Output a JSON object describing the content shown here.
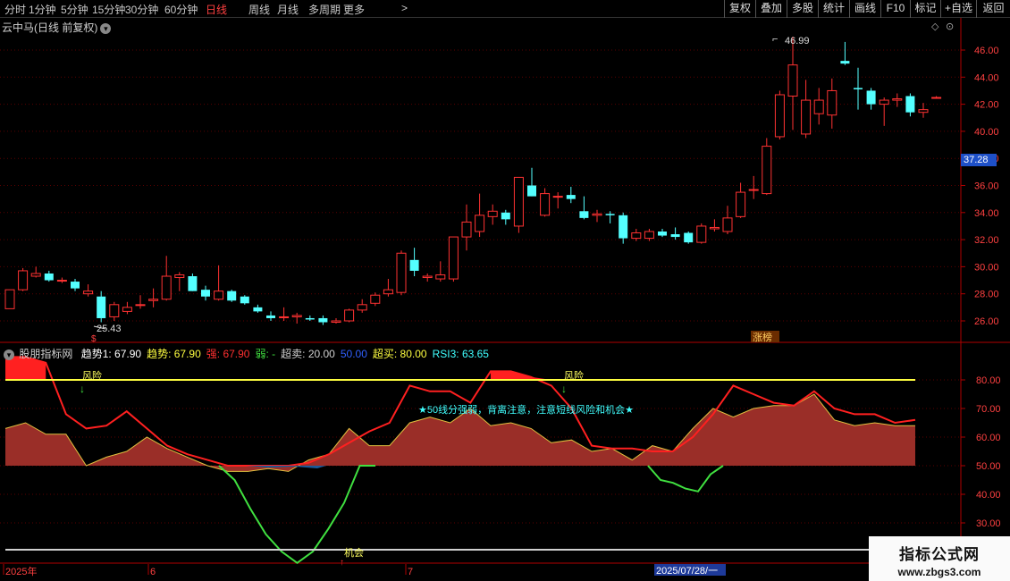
{
  "toolbar": {
    "periods": [
      "分时",
      "1分钟",
      "5分钟",
      "15分钟",
      "30分钟",
      "60分钟",
      "日线",
      "周线",
      "月线",
      "多周期",
      "更多"
    ],
    "active_period": "日线",
    "more_arrow": ">",
    "right_buttons": [
      "复权",
      "叠加",
      "多股",
      "统计",
      "画线",
      "F10",
      "标记",
      "+自选",
      "返回"
    ]
  },
  "stock": {
    "title": "云中马(日线 前复权)",
    "high_label": "46.99",
    "low_label": "25.43",
    "current_price": "37.28",
    "tag_label": "涨榜"
  },
  "price_axis": [
    "46.00",
    "44.00",
    "42.00",
    "40.00",
    "38.00",
    "36.00",
    "34.00",
    "32.00",
    "30.00",
    "28.00",
    "26.00"
  ],
  "indicator": {
    "name": "股朋指标网",
    "items": [
      {
        "label": "趋势1: 67.90",
        "color": "#ffffff"
      },
      {
        "label": "趋势: 67.90",
        "color": "#ffff40"
      },
      {
        "label": "强: 67.90",
        "color": "#ff3030"
      },
      {
        "label": "弱: -",
        "color": "#40e040"
      },
      {
        "label": "超卖: 20.00",
        "color": "#d0d0d0"
      },
      {
        "label": "50.00",
        "color": "#3060ff"
      },
      {
        "label": "超买: 80.00",
        "color": "#ffff40"
      },
      {
        "label": "RSI3: 63.65",
        "color": "#40ffff"
      }
    ],
    "risk_label": "风险",
    "chance_label": "机会",
    "note": "★50线分强弱，背离注意，注意短线风险和机会★",
    "axis": [
      "80.00",
      "70.00",
      "60.00",
      "50.00",
      "40.00",
      "30.00"
    ]
  },
  "date_axis": {
    "labels": [
      "2025年",
      "6",
      "7"
    ],
    "cursor_date": "2025/07/28/一"
  },
  "watermark": {
    "line1": "指标公式网",
    "line2": "www.zbgs3.com"
  },
  "colors": {
    "up": "#ff3232",
    "down": "#54ffff",
    "axis_red": "#b00000",
    "overbought": "#ffff40",
    "strong_fill": "#9a2e28",
    "weak_line": "#40e040"
  },
  "chart_data": {
    "type": "candlestick",
    "candles": [
      [
        26.9,
        28.3,
        26.9,
        28.3
      ],
      [
        28.3,
        29.9,
        28.2,
        29.7
      ],
      [
        29.3,
        30.0,
        29.2,
        29.5
      ],
      [
        29.5,
        29.7,
        28.9,
        29.0
      ],
      [
        29.0,
        29.2,
        28.8,
        29.0
      ],
      [
        28.9,
        29.1,
        28.2,
        28.4
      ],
      [
        28.0,
        28.7,
        27.8,
        28.2
      ],
      [
        27.8,
        28.2,
        25.9,
        26.2
      ],
      [
        26.3,
        27.4,
        26.0,
        27.2
      ],
      [
        26.7,
        27.4,
        26.5,
        27.0
      ],
      [
        27.2,
        27.9,
        26.9,
        27.2
      ],
      [
        27.5,
        28.4,
        27.0,
        27.6
      ],
      [
        27.6,
        30.8,
        27.5,
        29.3
      ],
      [
        29.2,
        29.6,
        28.2,
        29.4
      ],
      [
        29.3,
        29.5,
        28.2,
        28.2
      ],
      [
        28.3,
        28.6,
        27.5,
        27.8
      ],
      [
        27.6,
        30.1,
        27.5,
        28.2
      ],
      [
        28.2,
        28.3,
        27.4,
        27.5
      ],
      [
        27.8,
        27.9,
        27.2,
        27.3
      ],
      [
        27.0,
        27.2,
        26.6,
        26.7
      ],
      [
        26.4,
        26.7,
        26.0,
        26.2
      ],
      [
        26.3,
        27.0,
        26.0,
        26.3
      ],
      [
        26.3,
        26.6,
        25.8,
        26.4
      ],
      [
        26.2,
        26.4,
        26.0,
        26.1
      ],
      [
        26.2,
        26.4,
        25.7,
        25.9
      ],
      [
        25.9,
        26.2,
        25.8,
        26.0
      ],
      [
        26.0,
        26.9,
        25.9,
        26.8
      ],
      [
        26.8,
        27.6,
        26.6,
        27.2
      ],
      [
        27.3,
        28.1,
        27.1,
        27.9
      ],
      [
        28.0,
        29.1,
        27.8,
        28.3
      ],
      [
        28.1,
        31.2,
        27.9,
        31.0
      ],
      [
        30.5,
        31.4,
        29.3,
        29.7
      ],
      [
        29.2,
        29.5,
        28.9,
        29.3
      ],
      [
        29.1,
        30.4,
        28.9,
        29.4
      ],
      [
        29.1,
        32.2,
        28.9,
        32.2
      ],
      [
        32.2,
        34.6,
        31.2,
        33.3
      ],
      [
        32.6,
        35.4,
        32.2,
        33.8
      ],
      [
        33.7,
        34.6,
        33.1,
        34.1
      ],
      [
        34.0,
        34.2,
        33.1,
        33.5
      ],
      [
        33.0,
        36.6,
        32.5,
        36.6
      ],
      [
        36.0,
        37.3,
        35.2,
        35.2
      ],
      [
        33.8,
        35.8,
        33.7,
        35.4
      ],
      [
        35.2,
        35.5,
        34.3,
        35.2
      ],
      [
        35.3,
        35.9,
        34.7,
        35.0
      ],
      [
        34.1,
        35.2,
        33.5,
        33.6
      ],
      [
        33.8,
        34.2,
        33.3,
        33.9
      ],
      [
        33.9,
        34.1,
        33.2,
        33.8
      ],
      [
        33.8,
        34.0,
        31.7,
        32.1
      ],
      [
        32.1,
        32.8,
        31.9,
        32.5
      ],
      [
        32.1,
        32.8,
        31.9,
        32.6
      ],
      [
        32.6,
        32.8,
        32.2,
        32.3
      ],
      [
        32.4,
        32.9,
        32.0,
        32.2
      ],
      [
        32.5,
        32.6,
        31.7,
        31.8
      ],
      [
        31.8,
        33.2,
        31.7,
        33.0
      ],
      [
        32.8,
        33.5,
        32.6,
        32.9
      ],
      [
        32.6,
        34.5,
        32.4,
        33.6
      ],
      [
        33.7,
        36.2,
        33.6,
        35.5
      ],
      [
        35.7,
        36.7,
        35.0,
        35.7
      ],
      [
        35.4,
        39.5,
        35.3,
        38.9
      ],
      [
        39.6,
        43.0,
        39.4,
        42.7
      ],
      [
        42.6,
        46.99,
        40.1,
        44.9
      ],
      [
        39.8,
        43.8,
        39.5,
        42.3
      ],
      [
        41.3,
        43.2,
        40.5,
        42.3
      ],
      [
        41.2,
        43.9,
        40.2,
        43.0
      ],
      [
        45.2,
        46.6,
        44.9,
        45.0
      ],
      [
        43.2,
        44.7,
        41.6,
        43.1
      ],
      [
        43.0,
        43.2,
        41.6,
        42.0
      ],
      [
        42.0,
        42.5,
        40.4,
        42.3
      ],
      [
        42.3,
        42.8,
        41.8,
        42.4
      ],
      [
        42.6,
        42.8,
        41.1,
        41.4
      ],
      [
        41.4,
        42.1,
        41.0,
        41.6
      ],
      [
        42.5,
        42.6,
        42.4,
        42.5
      ]
    ],
    "indicator": {
      "x": [
        0,
        2,
        4,
        6,
        8,
        10,
        12,
        14,
        16,
        18,
        20,
        22,
        24,
        26,
        28,
        30,
        32,
        34,
        36,
        38,
        40,
        42,
        44,
        46,
        48,
        50,
        52,
        54,
        56,
        58,
        60,
        62,
        64,
        66,
        68,
        70,
        71
      ],
      "rsi3": [
        63,
        65,
        61,
        61,
        50,
        53,
        55,
        60,
        56,
        53,
        50,
        48,
        48,
        49,
        48,
        52,
        54,
        63,
        57,
        57,
        65,
        67,
        65,
        70,
        64,
        65,
        63,
        58,
        59,
        55,
        56,
        52,
        57,
        55,
        63,
        70,
        67,
        70,
        71,
        71,
        75,
        66,
        64,
        65,
        64,
        64
      ],
      "strong": [
        88,
        88,
        86,
        68,
        63,
        64,
        69,
        63,
        57,
        54,
        52,
        50,
        50,
        50,
        50,
        51,
        54,
        58,
        62,
        65,
        78,
        76,
        76,
        72,
        83,
        83,
        81,
        78,
        70,
        57,
        56,
        56,
        55,
        55,
        60,
        68,
        78,
        75,
        72,
        71,
        76,
        70,
        68,
        68,
        65,
        66
      ],
      "weak": [
        50,
        45,
        35,
        26,
        20,
        16,
        20,
        28,
        37,
        50,
        50,
        45,
        42,
        40,
        47,
        50,
        50,
        50,
        50,
        50,
        50,
        50
      ],
      "overbought": 80,
      "oversold": 20,
      "mid": 50
    }
  }
}
